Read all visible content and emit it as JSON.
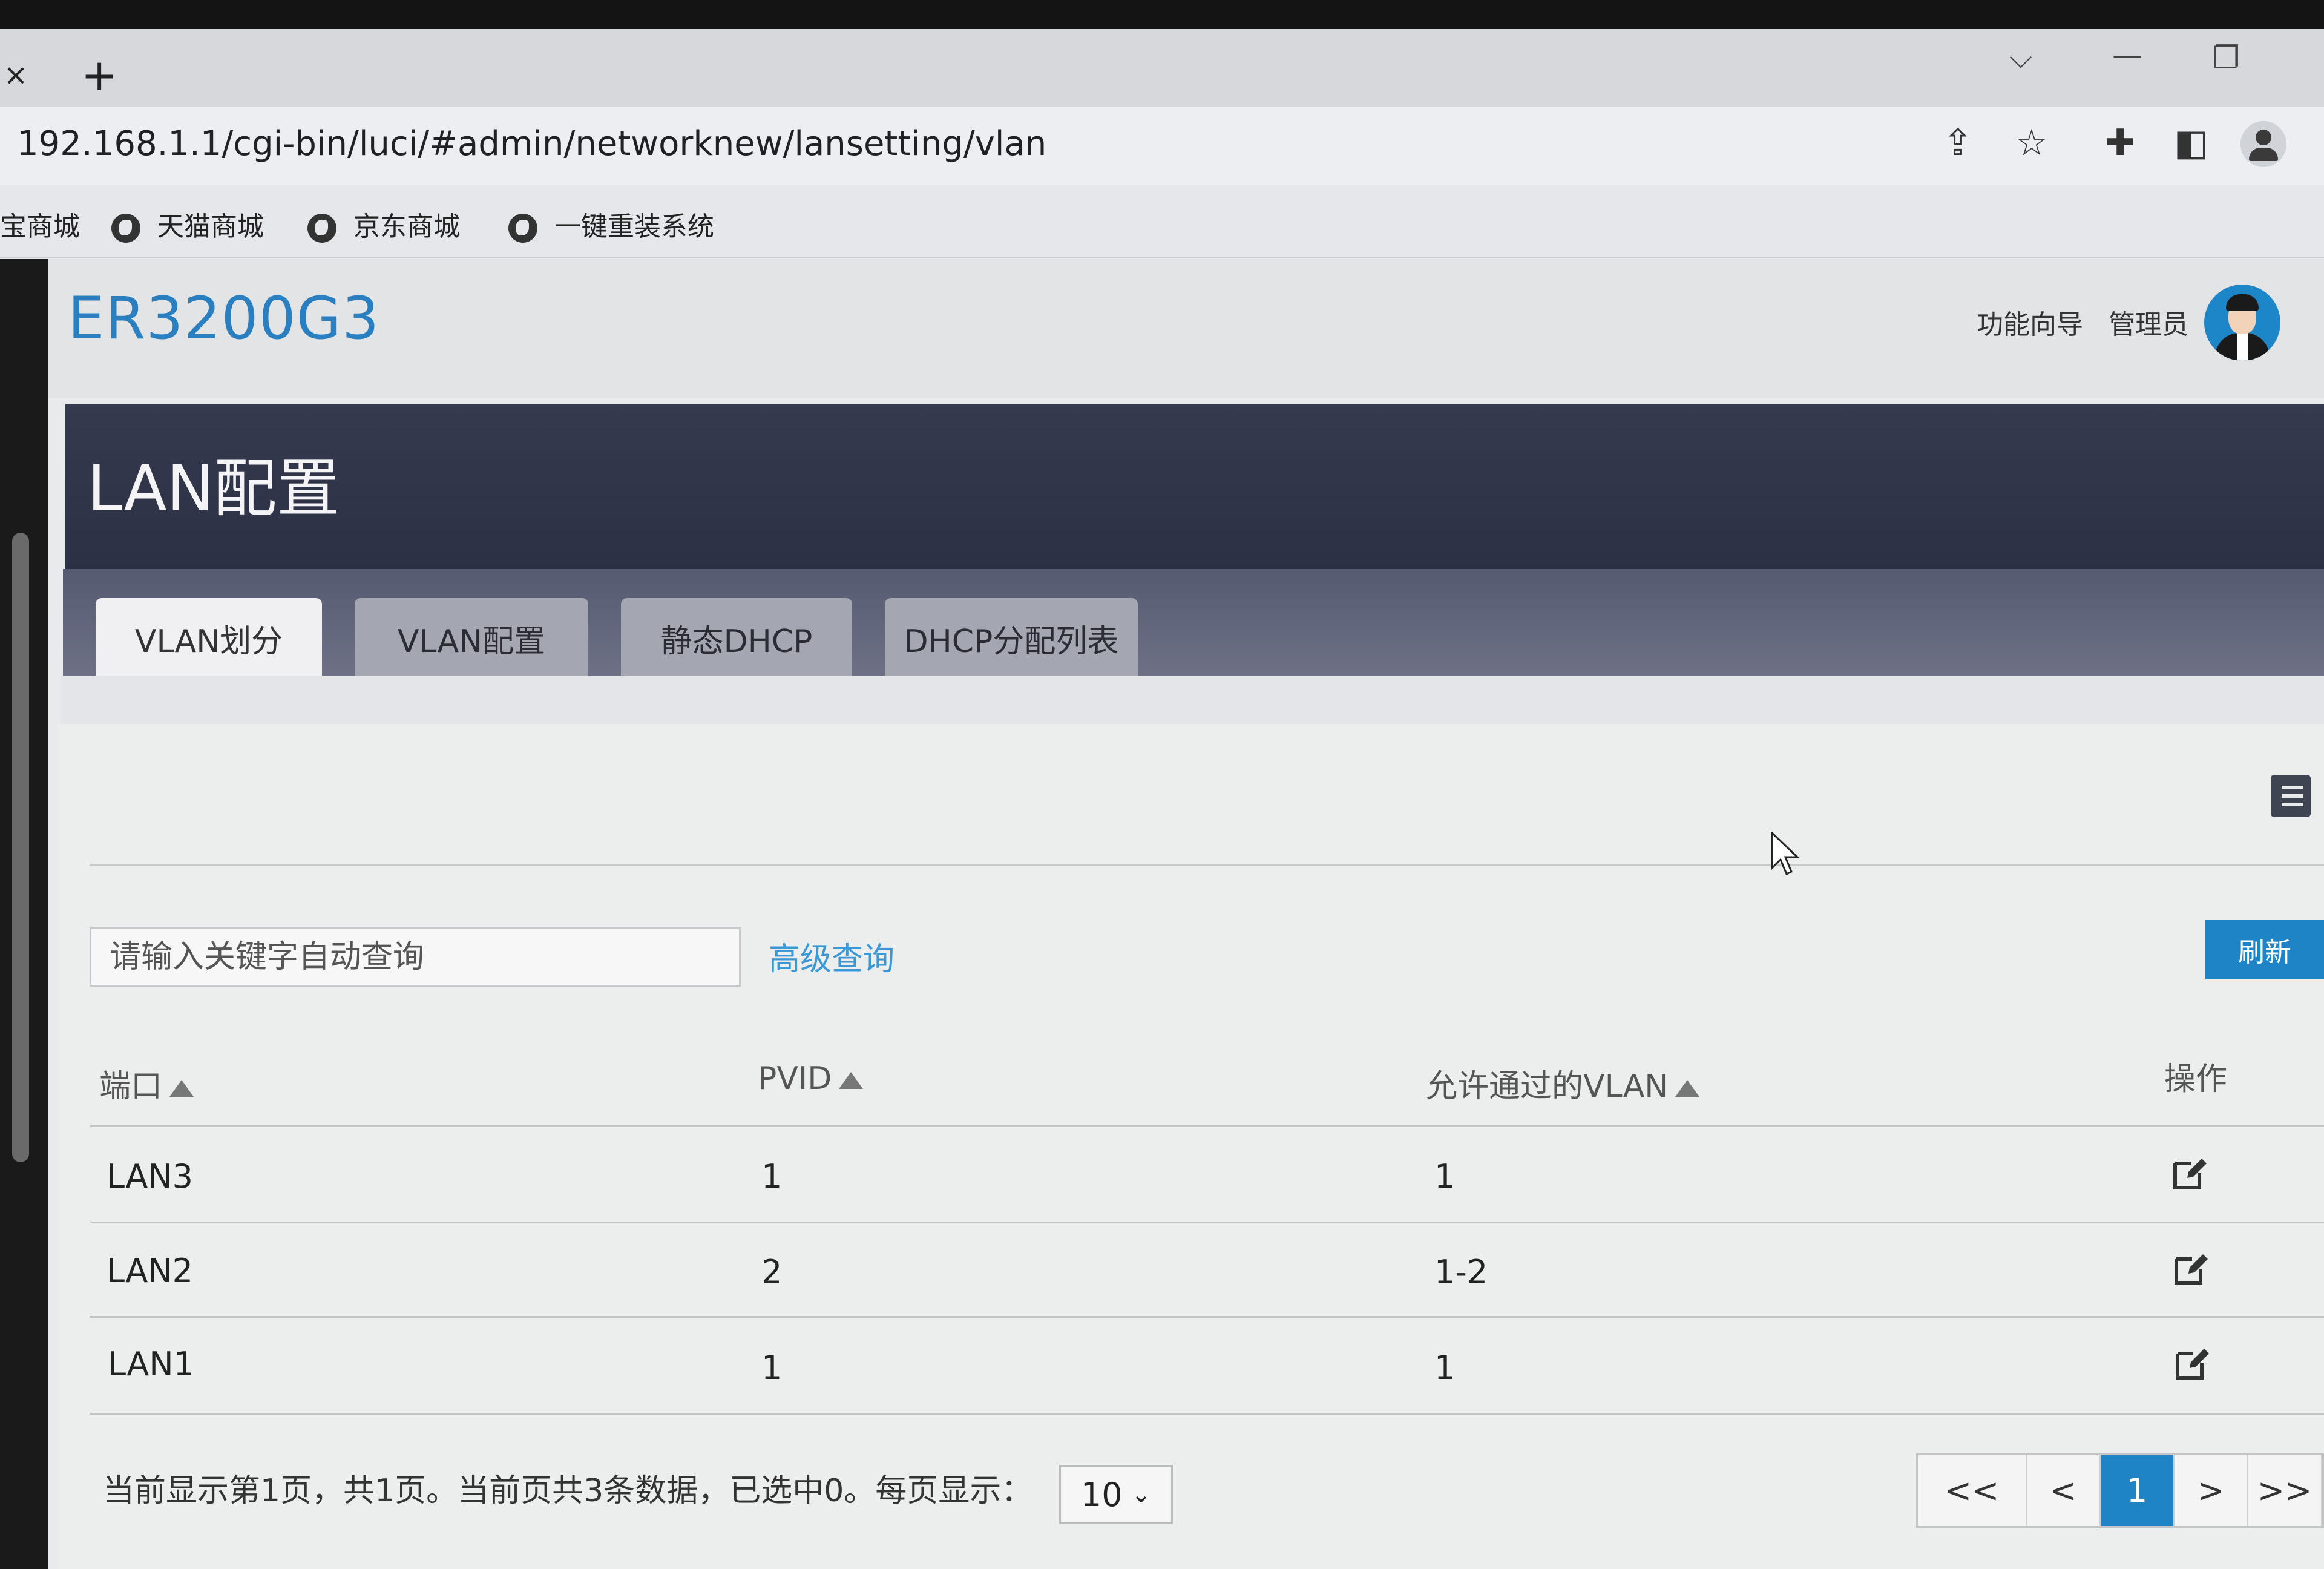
{
  "browser": {
    "tab_close": "×",
    "tab_new": "+",
    "url": "192.168.1.1/cgi-bin/luci/#admin/networknew/lansetting/vlan",
    "bookmarks": [
      "宝商城",
      "天猫商城",
      "京东商城",
      "一键重装系统"
    ]
  },
  "header": {
    "brand": "ER3200G3",
    "wizard": "功能向导",
    "admin": "管理员"
  },
  "page": {
    "title": "LAN配置",
    "tabs": [
      "VLAN划分",
      "VLAN配置",
      "静态DHCP",
      "DHCP分配列表"
    ],
    "active_tab": 0
  },
  "search": {
    "placeholder": "请输入关键字自动查询",
    "advanced": "高级查询",
    "refresh": "刷新"
  },
  "table": {
    "headers": [
      "端口",
      "PVID",
      "允许通过的VLAN",
      "操作"
    ],
    "rows": [
      {
        "port": "LAN3",
        "pvid": "1",
        "vlan": "1"
      },
      {
        "port": "LAN2",
        "pvid": "2",
        "vlan": "1-2"
      },
      {
        "port": "LAN1",
        "pvid": "1",
        "vlan": "1"
      }
    ]
  },
  "footer": {
    "status": "当前显示第1页，共1页。当前页共3条数据，已选中0。每页显示：",
    "page_size": "10",
    "pager": [
      "<<",
      "<",
      "1",
      ">",
      ">>"
    ]
  },
  "colors": {
    "brand": "#2a7fc1",
    "accent": "#1e84c5",
    "banner": "#30344a"
  }
}
